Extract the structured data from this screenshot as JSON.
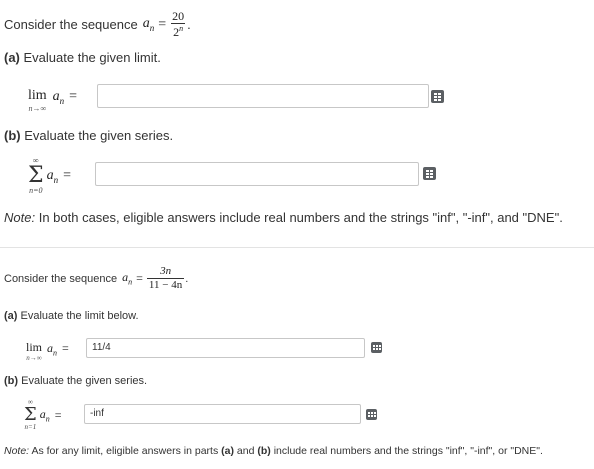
{
  "problem1": {
    "intro": "Consider the sequence",
    "sequence_lhs": "a",
    "sequence_sub": "n",
    "numerator": "20",
    "denominator_base": "2",
    "denominator_exp": "n",
    "part_a_label": "(a)",
    "part_a_text": "Evaluate the given limit.",
    "limit_word": "lim",
    "limit_sub": "n→∞",
    "limit_value": "",
    "part_b_label": "(b)",
    "part_b_text": "Evaluate the given series.",
    "sum_upper": "∞",
    "sum_lower": "n=0",
    "series_value": "",
    "note_label": "Note:",
    "note_text": "In both cases, eligible answers include real numbers and the strings \"inf\", \"-inf\", and \"DNE\"."
  },
  "problem2": {
    "intro": "Consider the sequence",
    "numerator": "3n",
    "denominator": "11 − 4n",
    "part_a_label": "(a)",
    "part_a_text": "Evaluate the limit below.",
    "limit_word": "lim",
    "limit_sub": "n→∞",
    "limit_value": "11/4",
    "part_b_label": "(b)",
    "part_b_text": "Evaluate the given series.",
    "sum_upper": "∞",
    "sum_lower": "n=1",
    "series_value": "-inf",
    "note_label": "Note:",
    "note_pre": "As for any limit, eligible answers in parts",
    "note_a": "(a)",
    "note_and": "and",
    "note_b": "(b)",
    "note_post": "include real numbers and the strings \"inf\", \"-inf\", or \"DNE\"."
  },
  "icons": {
    "keyboard": "keyboard-icon",
    "color": "#5b5f63"
  }
}
